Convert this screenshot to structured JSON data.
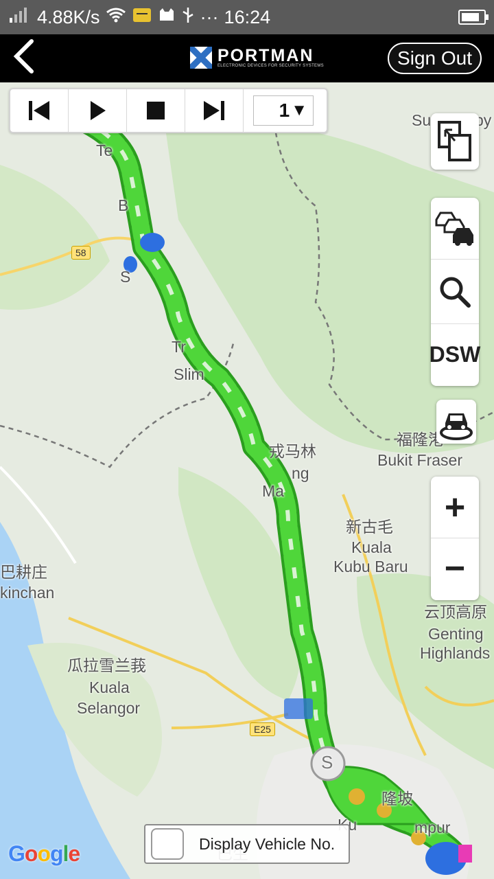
{
  "status_bar": {
    "net_speed": "4.88K/s",
    "time": "16:24",
    "dots": "···"
  },
  "header": {
    "back_icon": "chevron-left-icon",
    "brand": "PORTMAN",
    "tagline": "ELECTRONIC DEVICES FOR SECURITY SYSTEMS",
    "sign_out": "Sign Out"
  },
  "playback": {
    "speed_value": "1",
    "dropdown_arrow": "▼"
  },
  "controls": {
    "dsw_label": "DSW",
    "zoom_in": "+",
    "zoom_out": "−"
  },
  "map": {
    "places": [
      {
        "key": "sungai",
        "text": "Su"
      },
      {
        "key": "sungai_py",
        "text": "py"
      },
      {
        "key": "te",
        "text": "Te"
      },
      {
        "key": "b",
        "text": "B"
      },
      {
        "key": "sg",
        "text": "S"
      },
      {
        "key": "tr",
        "text": "Tr"
      },
      {
        "key": "slim",
        "text": "Slim"
      },
      {
        "key": "fraser_cn",
        "text": "福隆港"
      },
      {
        "key": "fraser_en",
        "text": "Bukit Fraser"
      },
      {
        "key": "tanjong_cn",
        "text": "戎马林"
      },
      {
        "key": "tanjong_en",
        "text": "ng"
      },
      {
        "key": "ma",
        "text": "Ma"
      },
      {
        "key": "kubu_cn",
        "text": "新古毛"
      },
      {
        "key": "kubu_en1",
        "text": "Kuala"
      },
      {
        "key": "kubu_en2",
        "text": "Kubu Baru"
      },
      {
        "key": "tinggi_cn",
        "text": "巴耕庄"
      },
      {
        "key": "tinggi_en",
        "text": "kinchan"
      },
      {
        "key": "genting_cn",
        "text": "云顶高原"
      },
      {
        "key": "genting_en1",
        "text": "Genting"
      },
      {
        "key": "genting_en2",
        "text": "Highlands"
      },
      {
        "key": "ks_cn",
        "text": "瓜拉雪兰莪"
      },
      {
        "key": "ks_en1",
        "text": "Kuala"
      },
      {
        "key": "ks_en2",
        "text": "Selangor"
      },
      {
        "key": "kl_cn",
        "text": "隆坡"
      },
      {
        "key": "kl_en",
        "text": "mpur"
      },
      {
        "key": "klang_cn",
        "text": "巴生"
      },
      {
        "key": "ku",
        "text": "Ku"
      }
    ],
    "road_58": "58",
    "road_e25": "E25",
    "start_marker": "S"
  },
  "google_logo": [
    "G",
    "o",
    "o",
    "g",
    "l",
    "e"
  ],
  "display_vehicle": {
    "label": "Display Vehicle No."
  }
}
